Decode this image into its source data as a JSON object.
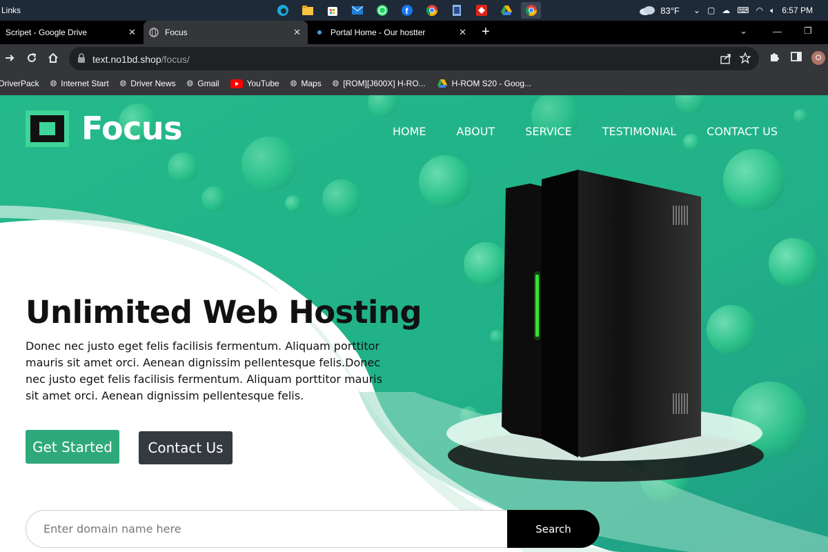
{
  "taskbar": {
    "links_label": "Links",
    "weather_temp": "83°F",
    "time": "6:57 PM",
    "icons": [
      "edge-icon",
      "file-explorer-icon",
      "store-icon",
      "mail-icon",
      "whatsapp-icon",
      "facebook-icon",
      "chrome-icon",
      "video-editor-icon",
      "anydesk-icon",
      "google-drive-icon",
      "chrome-active-icon"
    ]
  },
  "tabs": [
    {
      "title": "Scripet - Google Drive",
      "icon": "google-drive-icon"
    },
    {
      "title": "Focus",
      "icon": "globe-icon"
    },
    {
      "title": "Portal Home - Our hostter",
      "icon": "site-icon"
    }
  ],
  "address": {
    "host": "text.no1bd.shop",
    "path": "/focus/"
  },
  "bookmarks": [
    {
      "label": "DriverPack",
      "icon": "none"
    },
    {
      "label": "Internet Start",
      "icon": "globe-icon"
    },
    {
      "label": "Driver News",
      "icon": "globe-icon"
    },
    {
      "label": "Gmail",
      "icon": "globe-icon"
    },
    {
      "label": "YouTube",
      "icon": "youtube-icon"
    },
    {
      "label": "Maps",
      "icon": "globe-icon"
    },
    {
      "label": "[ROM][J600X] H-RO...",
      "icon": "globe-icon"
    },
    {
      "label": "H-ROM S20 - Goog...",
      "icon": "google-drive-icon"
    }
  ],
  "profile_initial": "O",
  "site": {
    "logo_text": "Focus",
    "nav": [
      "HOME",
      "ABOUT",
      "SERVICE",
      "TESTIMONIAL",
      "CONTACT US"
    ],
    "hero_title": "Unlimited Web Hosting",
    "hero_text": "Donec nec justo eget felis facilisis fermentum. Aliquam porttitor mauris sit amet orci. Aenean dignissim pellentesque felis.Donec nec justo eget felis facilisis fermentum. Aliquam porttitor mauris sit amet orci. Aenean dignissim pellentesque felis.",
    "get_started": "Get Started",
    "contact_us": "Contact Us",
    "search_placeholder": "Enter domain name here",
    "search_button": "Search"
  },
  "colors": {
    "accent": "#2fa97b",
    "logo_green": "#3ed598",
    "dark_button": "#343a40"
  }
}
